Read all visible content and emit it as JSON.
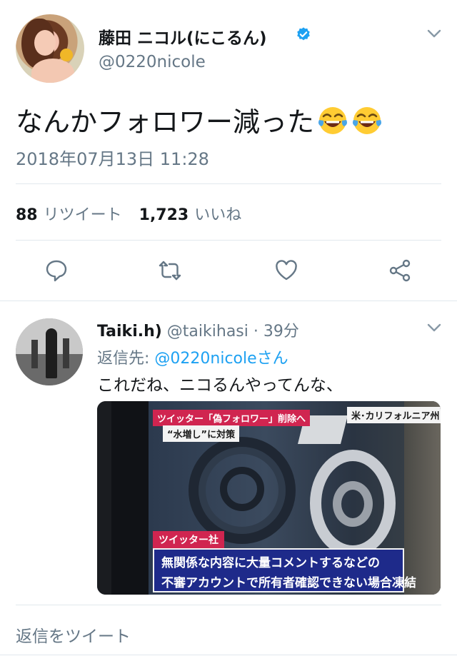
{
  "tweet": {
    "author_name": "藤田 ニコル(にこるん)",
    "author_handle": "@0220nicole",
    "text": "なんかフォロワー減った",
    "emojis": [
      "face-with-tears-of-joy",
      "face-with-tears-of-joy"
    ],
    "timestamp": "2018年07月13日 11:28",
    "retweet_count": "88",
    "retweet_label": "リツイート",
    "like_count": "1,723",
    "like_label": "いいね",
    "actions": [
      "reply-icon",
      "retweet-icon",
      "like-icon",
      "share-icon"
    ]
  },
  "reply": {
    "author_name": "Taiki.h)",
    "meta": " @taikihasi · 39分",
    "reply_prefix": "返信先: ",
    "reply_to": "@0220nicoleさん",
    "text": "これだね、ニコるんやってんな、",
    "media": {
      "caption_top": "ツイッター「偽フォロワー」削除へ",
      "caption_sub": "“水増し”に対策",
      "caption_location": "米･カリフォルニア州",
      "caption_label": "ツイッター社",
      "caption_line1": "無関係な内容に大量コメントするなどの",
      "caption_line2": "不審アカウントで所有者確認できない場合凍結"
    }
  },
  "composer": {
    "placeholder": "返信をツイート"
  },
  "colors": {
    "accent": "#1da1f2",
    "text_secondary": "#657786",
    "divider": "#e1e8ed",
    "caption_red": "#d02550",
    "caption_blue": "#1e2a8a"
  }
}
